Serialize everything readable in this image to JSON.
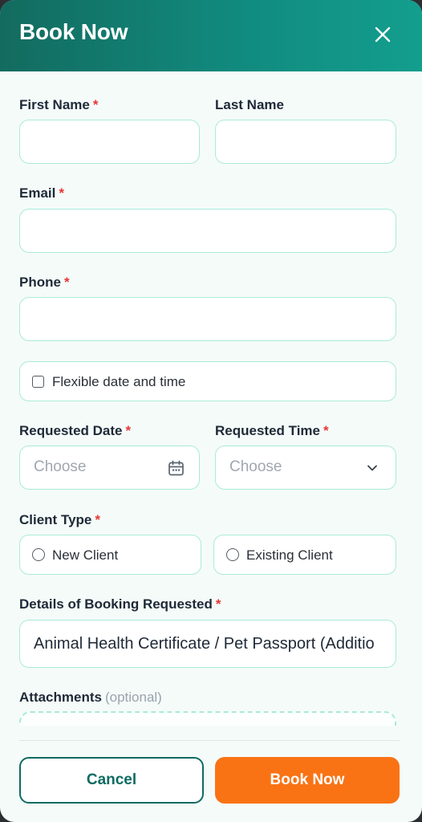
{
  "header": {
    "title": "Book Now"
  },
  "form": {
    "first_name": {
      "label": "First Name",
      "required_mark": "*",
      "value": ""
    },
    "last_name": {
      "label": "Last Name",
      "value": ""
    },
    "email": {
      "label": "Email",
      "required_mark": "*",
      "value": ""
    },
    "phone": {
      "label": "Phone",
      "required_mark": "*",
      "value": ""
    },
    "flexible": {
      "label": "Flexible date and time",
      "checked": false
    },
    "requested_date": {
      "label": "Requested Date",
      "required_mark": "*",
      "placeholder": "Choose",
      "icon": "calendar-icon"
    },
    "requested_time": {
      "label": "Requested Time",
      "required_mark": "*",
      "placeholder": "Choose",
      "icon": "chevron-down-icon"
    },
    "client_type": {
      "label": "Client Type",
      "required_mark": "*",
      "options": [
        "New Client",
        "Existing Client"
      ],
      "selected": null
    },
    "details": {
      "label": "Details of Booking Requested",
      "required_mark": "*",
      "value": "Animal Health Certificate / Pet Passport (Additio"
    },
    "attachments": {
      "label": "Attachments",
      "optional_note": "(optional)"
    }
  },
  "footer": {
    "cancel_label": "Cancel",
    "submit_label": "Book Now"
  },
  "colors": {
    "header_start": "#136b5f",
    "header_end": "#139e8e",
    "accent": "#0e6b62",
    "field_border": "#a9ebd9",
    "primary_button": "#f97315",
    "required": "#e53935"
  }
}
